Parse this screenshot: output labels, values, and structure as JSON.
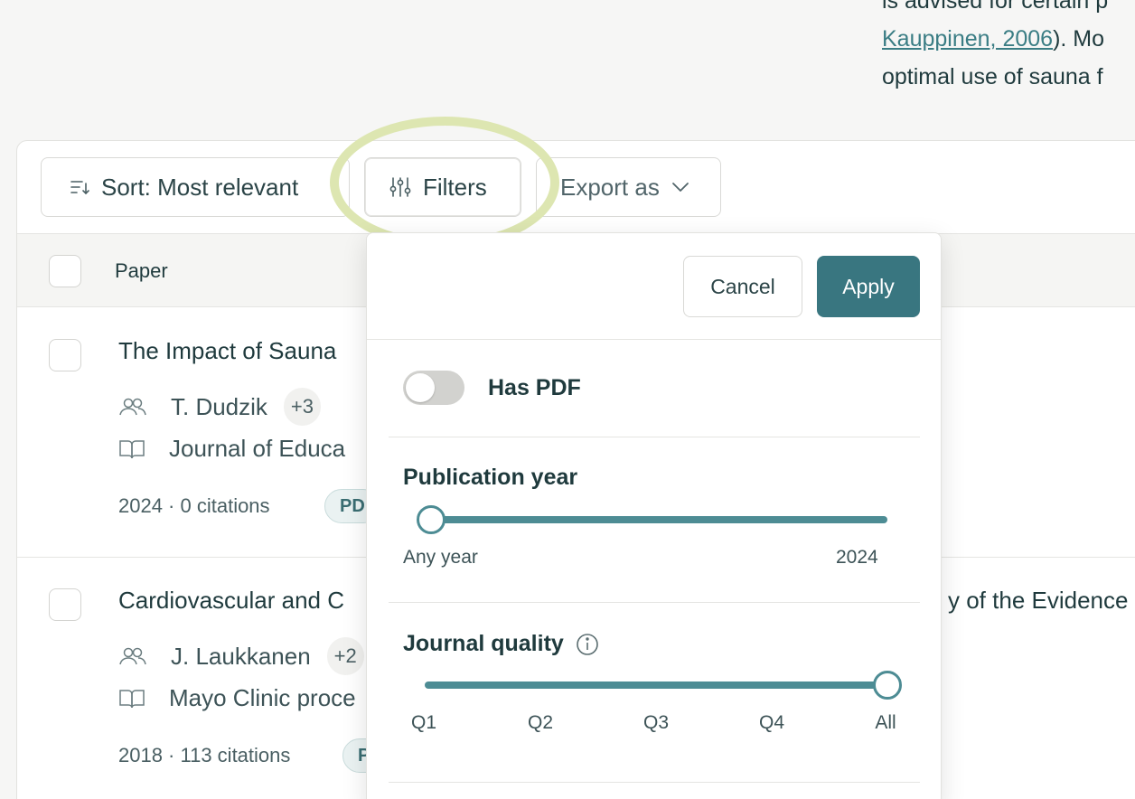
{
  "article": {
    "line0": "is advised for certain p",
    "citation_link": "Kauppinen, 2006",
    "line1_tail": "). Mo",
    "line2": "optimal use of sauna f"
  },
  "toolbar": {
    "sort_label": "Sort: Most relevant",
    "filters_label": "Filters",
    "export_label": "Export as"
  },
  "table": {
    "column_paper": "Paper"
  },
  "papers": [
    {
      "title": "The Impact of Sauna",
      "author": "T. Dudzik",
      "more_authors": "+3",
      "journal": "Journal of Educa",
      "stats": "2024 · 0 citations",
      "chip": "PD"
    },
    {
      "title": "Cardiovascular and C",
      "title_tail": "y of the Evidence",
      "author": "J. Laukkanen",
      "more_authors": "+2",
      "journal": "Mayo Clinic proce",
      "stats": "2018 · 113 citations",
      "chip": "P"
    }
  ],
  "filters": {
    "cancel_label": "Cancel",
    "apply_label": "Apply",
    "has_pdf_label": "Has PDF",
    "has_pdf_enabled": false,
    "publication_year": {
      "title": "Publication year",
      "min_label": "Any year",
      "max_label": "2024",
      "selected_from": "Any year",
      "selected_to": "2024"
    },
    "journal_quality": {
      "title": "Journal quality",
      "options": [
        "Q1",
        "Q2",
        "Q3",
        "Q4",
        "All"
      ],
      "selected": "All"
    }
  },
  "colors": {
    "accent": "#397680",
    "slider": "#4d8c94",
    "highlight_ring": "#dde6b1"
  }
}
